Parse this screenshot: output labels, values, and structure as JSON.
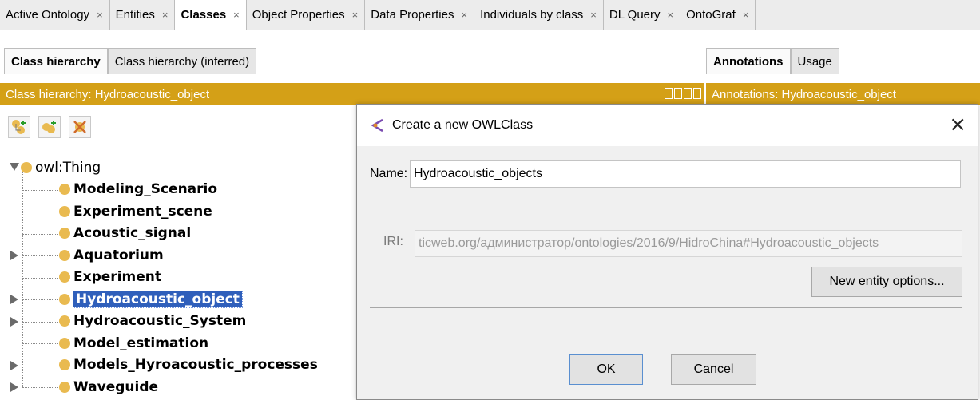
{
  "tabs": [
    {
      "label": "Active Ontology",
      "close": "×"
    },
    {
      "label": "Entities",
      "close": "×"
    },
    {
      "label": "Classes",
      "close": "×",
      "active": true
    },
    {
      "label": "Object Properties",
      "close": "×"
    },
    {
      "label": "Data Properties",
      "close": "×"
    },
    {
      "label": "Individuals by class",
      "close": "×"
    },
    {
      "label": "DL Query",
      "close": "×"
    },
    {
      "label": "OntoGraf",
      "close": "×"
    }
  ],
  "left_subtabs": [
    "Class hierarchy",
    "Class hierarchy (inferred)"
  ],
  "right_subtabs": [
    "Annotations",
    "Usage"
  ],
  "class_hierarchy_header": "Class hierarchy: Hydroacoustic_object",
  "annotations_header": "Annotations: Hydroacoustic_object",
  "tree": {
    "root": "owl:Thing",
    "items": [
      {
        "label": "Modeling_Scenario",
        "expandable": false
      },
      {
        "label": "Experiment_scene",
        "expandable": false
      },
      {
        "label": "Acoustic_signal",
        "expandable": false
      },
      {
        "label": "Aquatorium",
        "expandable": true
      },
      {
        "label": "Experiment",
        "expandable": false
      },
      {
        "label": "Hydroacoustic_object",
        "expandable": true,
        "selected": true
      },
      {
        "label": "Hydroacoustic_System",
        "expandable": true
      },
      {
        "label": "Model_estimation",
        "expandable": false
      },
      {
        "label": "Models_Hyroacoustic_processes",
        "expandable": true
      },
      {
        "label": "Waveguide",
        "expandable": true
      }
    ]
  },
  "dialog": {
    "title": "Create a new OWLClass",
    "close": "×",
    "name_label": "Name:",
    "name_value": "Hydroacoustic_objects",
    "iri_label": "IRI:",
    "iri_value": "ticweb.org/администратор/ontologies/2016/9/HidroChina#Hydroacoustic_objects",
    "options_button": "New entity options...",
    "ok_button": "OK",
    "cancel_button": "Cancel"
  },
  "colors": {
    "header_orange": "#d4a017",
    "class_dot": "#e9ba50",
    "selection": "#2f5fbb"
  }
}
